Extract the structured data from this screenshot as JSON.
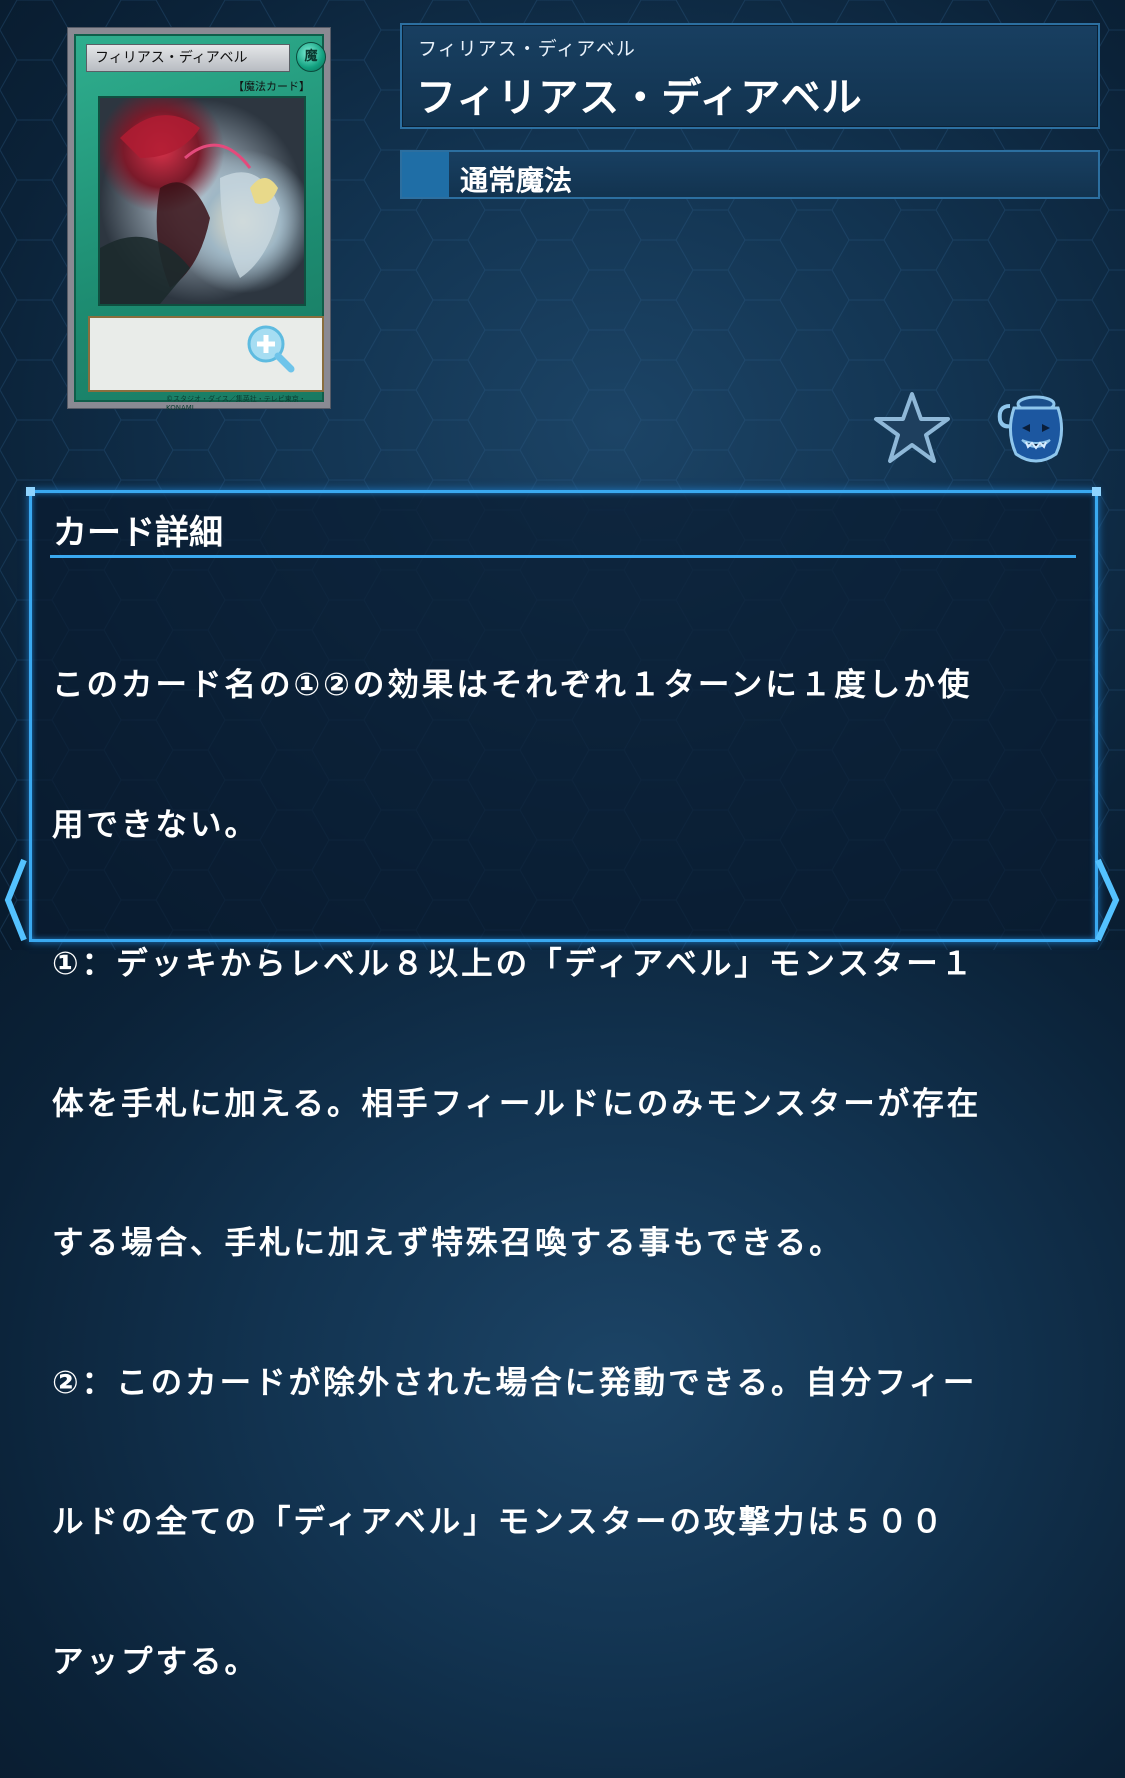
{
  "card": {
    "frame_name": "フィリアス・ディアベル",
    "attribute": "魔",
    "type_line": "【魔法カード】",
    "copyright": "©スタジオ・ダイス／集英社・テレビ東京・KONAMI",
    "zoom_icon": "zoom-in-icon"
  },
  "header": {
    "ruby": "フィリアス・ディアベル",
    "name": "フィリアス・ディアベル",
    "spell_type": "通常魔法"
  },
  "actions": {
    "favorite_icon": "star-icon",
    "deck_icon": "pot-of-greed-icon"
  },
  "detail": {
    "title": "カード詳細",
    "lines": [
      "このカード名の①②の効果はそれぞれ１ターンに１度しか使",
      "用できない。",
      "①：デッキからレベル８以上の「ディアベル」モンスター１",
      "体を手札に加える。相手フィールドにのみモンスターが存在",
      "する場合、手札に加えず特殊召喚する事もできる。",
      "②：このカードが除外された場合に発動できる。自分フィー",
      "ルドの全ての「ディアベル」モンスターの攻撃力は５００",
      "アップする。"
    ]
  },
  "nav": {
    "prev_icon": "chevron-left-icon",
    "next_icon": "chevron-right-icon"
  },
  "colors": {
    "accent": "#3aa9f0",
    "panel": "#12334f",
    "spell_green": "#1d8c71"
  }
}
